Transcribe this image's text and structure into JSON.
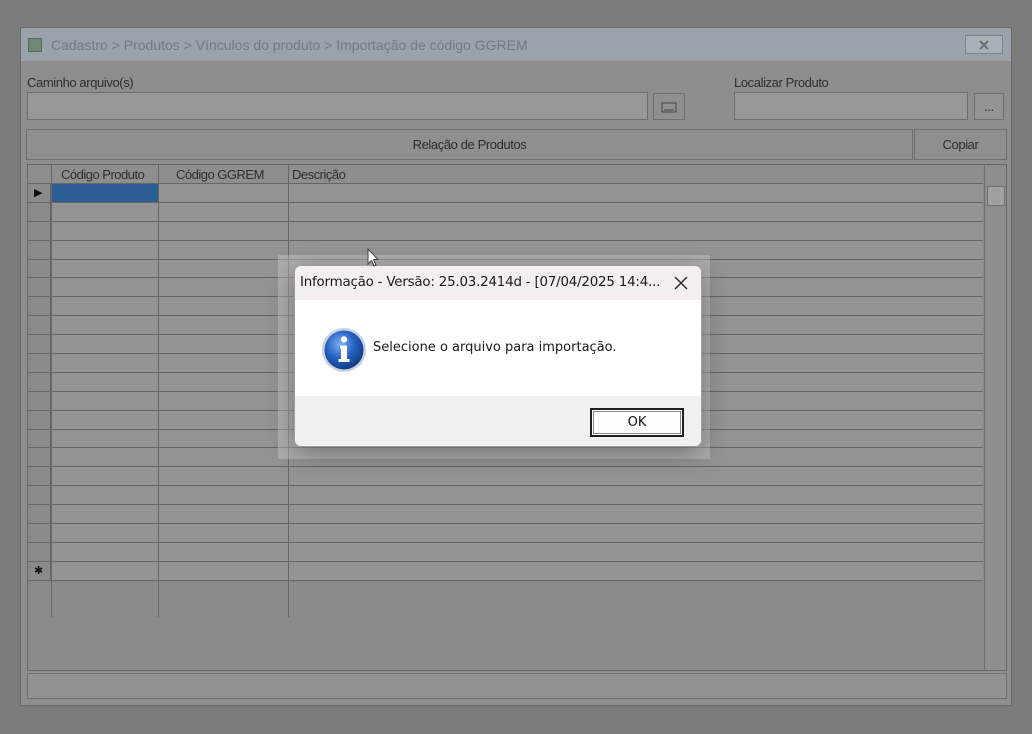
{
  "window": {
    "title": "Cadastro > Produtos > Vínculos do produto > Importação de código GGREM",
    "close_icon": "close-icon"
  },
  "form": {
    "file_path_label": "Caminho arquivo(s)",
    "file_path_value": "",
    "browse_button_icon": "folder-browse-icon",
    "product_search_label": "Localizar Produto",
    "product_search_value": "",
    "product_search_button_label": "...",
    "product_list_button_label": "Relação de Produtos",
    "copy_button_label": "Copiar"
  },
  "grid": {
    "columns": [
      "Código Produto",
      "Código GGREM",
      "Descrição"
    ],
    "row_count": 21,
    "current_row_marker": "▶",
    "new_row_marker": "✱",
    "rows": []
  },
  "dialog": {
    "title": "Informação - Versão: 25.03.2414d - [07/04/2025 14:4...",
    "icon": "info-icon",
    "message": "Selecione o arquivo para importação.",
    "ok_label": "OK"
  },
  "colors": {
    "selected_cell": "#2c5f95",
    "dialog_footer": "#f0f0f0",
    "info_icon_blue": "#1f5fb8"
  }
}
